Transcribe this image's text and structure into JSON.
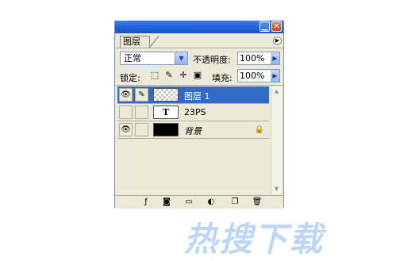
{
  "panel": {
    "tab_label": "图层",
    "blend_mode": "正常",
    "opacity_label": "不透明度:",
    "opacity_value": "100%",
    "lock_label": "锁定:",
    "fill_label": "填充:",
    "fill_value": "100%"
  },
  "layers": [
    {
      "name": "图层 1",
      "selected": true
    },
    {
      "name": "23PS",
      "selected": false
    },
    {
      "name": "背景",
      "selected": false
    }
  ],
  "watermark": "热搜下载"
}
